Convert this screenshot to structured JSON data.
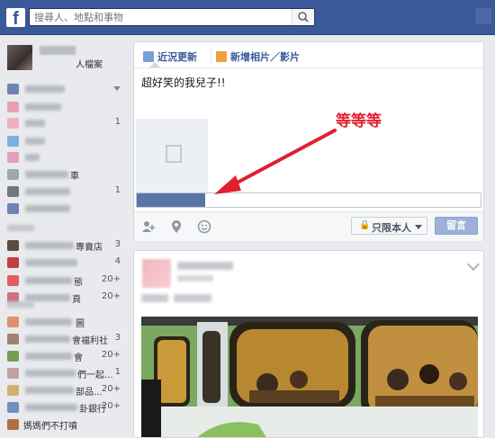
{
  "header": {
    "logo": "f",
    "search_placeholder": "搜尋人、地點和事物",
    "search_icon": "search-icon"
  },
  "sidebar": {
    "profile_edit": "人檔案",
    "items": [
      {
        "text": "",
        "count": ""
      },
      {
        "text": "",
        "count": "1"
      },
      {
        "text": "",
        "count": ""
      },
      {
        "text": "車",
        "count": ""
      },
      {
        "text": "",
        "count": "1"
      },
      {
        "text": "",
        "count": ""
      },
      {
        "text": "專賣店",
        "count": "3"
      },
      {
        "text": "",
        "count": "4"
      },
      {
        "text": "態",
        "count": "20+"
      },
      {
        "text": "頁",
        "count": "20+"
      },
      {
        "text": "圖",
        "count": ""
      },
      {
        "text": "會福利社",
        "count": "3"
      },
      {
        "text": "會",
        "count": "20+"
      },
      {
        "text": "們一起...",
        "count": "1"
      },
      {
        "text": "部品...",
        "count": "20+"
      },
      {
        "text": "卦銀行",
        "count": "20+"
      },
      {
        "text": "媽媽們不打噴",
        "count": ""
      }
    ]
  },
  "composer": {
    "tab_status": "近況更新",
    "tab_photo": "新增相片／影片",
    "post_text": "超好笑的我兒子!!",
    "upload_progress": 0.2,
    "privacy_label": "只限本人",
    "post_button": "留言"
  },
  "annotation": {
    "text": "等等等",
    "color": "#e02030"
  },
  "colors": {
    "brand": "#3b5998",
    "progress": "#5b74a8",
    "post_button": "#9cb1d9"
  }
}
